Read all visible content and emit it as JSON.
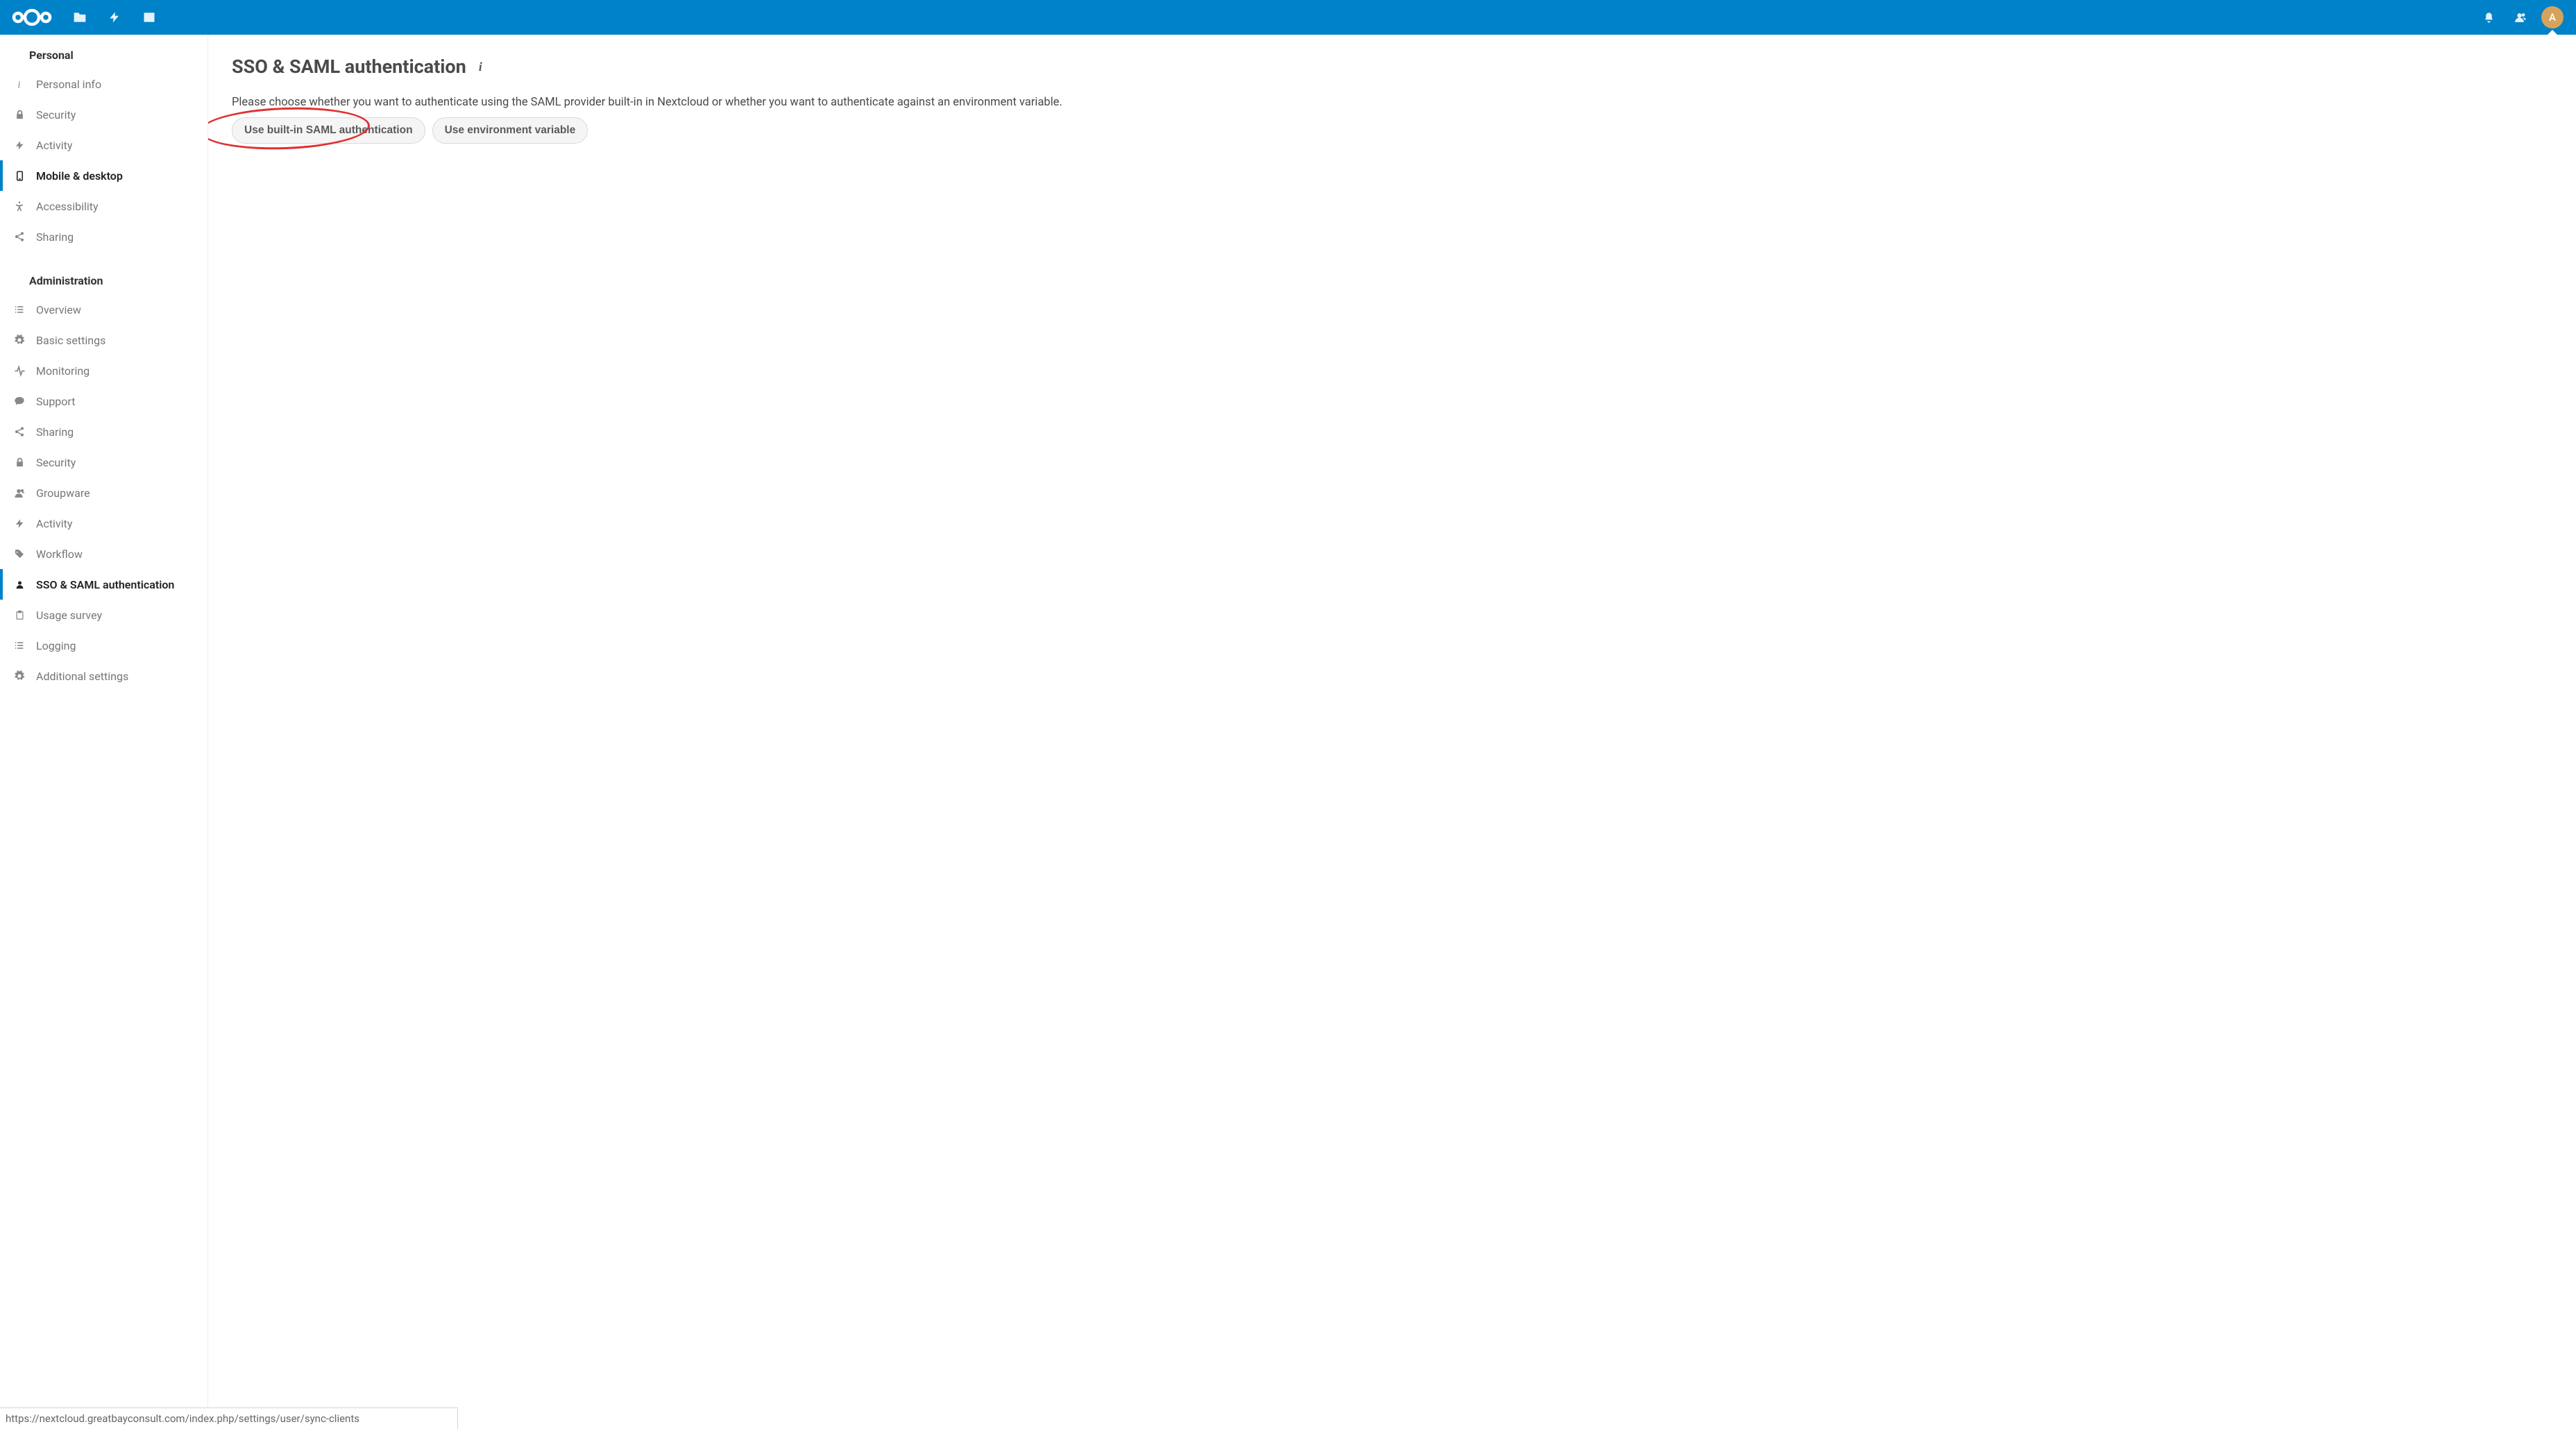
{
  "header": {
    "avatar_letter": "A"
  },
  "sidebar": {
    "section_personal": "Personal",
    "section_admin": "Administration",
    "personal_items": [
      {
        "label": "Personal info"
      },
      {
        "label": "Security"
      },
      {
        "label": "Activity"
      },
      {
        "label": "Mobile & desktop"
      },
      {
        "label": "Accessibility"
      },
      {
        "label": "Sharing"
      }
    ],
    "admin_items": [
      {
        "label": "Overview"
      },
      {
        "label": "Basic settings"
      },
      {
        "label": "Monitoring"
      },
      {
        "label": "Support"
      },
      {
        "label": "Sharing"
      },
      {
        "label": "Security"
      },
      {
        "label": "Groupware"
      },
      {
        "label": "Activity"
      },
      {
        "label": "Workflow"
      },
      {
        "label": "SSO & SAML authentication"
      },
      {
        "label": "Usage survey"
      },
      {
        "label": "Logging"
      },
      {
        "label": "Additional settings"
      }
    ]
  },
  "main": {
    "title": "SSO & SAML authentication",
    "description": "Please choose whether you want to authenticate using the SAML provider built-in in Nextcloud or whether you want to authenticate against an environment variable.",
    "button_builtin": "Use built-in SAML authentication",
    "button_env": "Use environment variable"
  },
  "statusbar": {
    "url": "https://nextcloud.greatbayconsult.com/index.php/settings/user/sync-clients"
  }
}
